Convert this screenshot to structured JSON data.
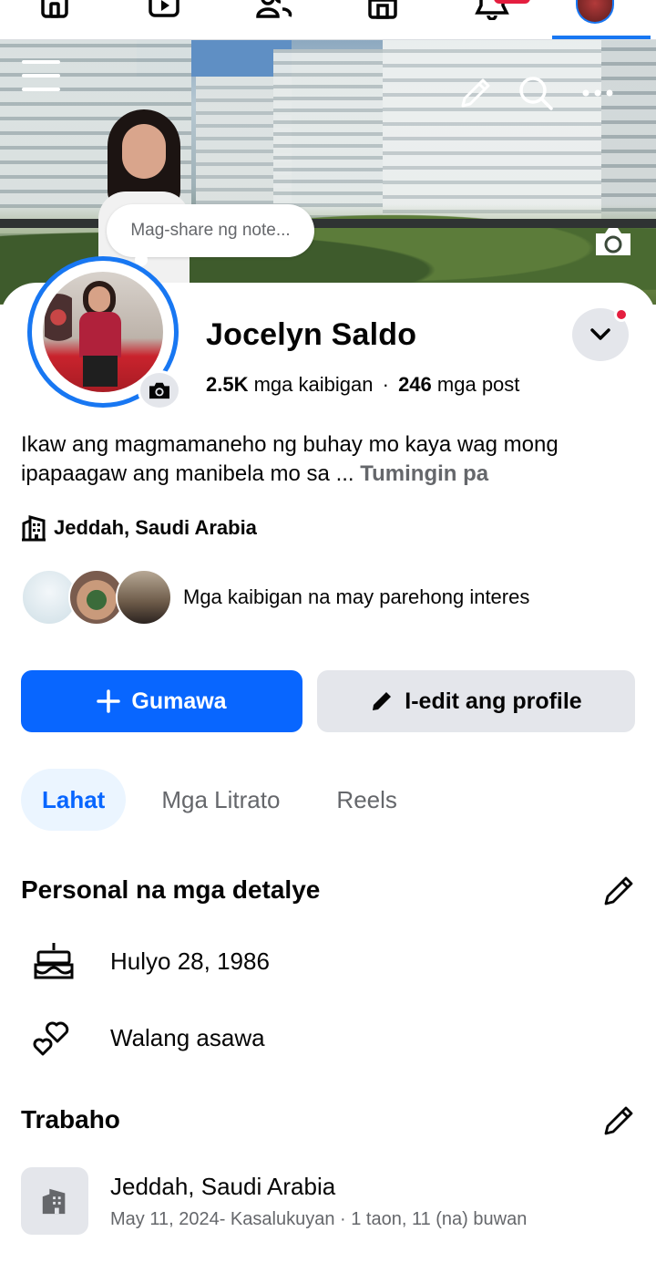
{
  "profile": {
    "name": "Jocelyn Saldo",
    "friends_count": "2.5K",
    "friends_label": "mga kaibigan",
    "separator": "·",
    "posts_count": "246",
    "posts_label": "mga post",
    "note_placeholder": "Mag-share ng note...",
    "bio": "Ikaw ang magmamaneho ng buhay mo kaya wag mong ipapaagaw ang manibela mo sa ...",
    "bio_more": "Tumingin pa",
    "location": "Jeddah, Saudi Arabia",
    "mutual_interest_text": "Mga kaibigan na may parehong interes"
  },
  "actions": {
    "create_label": "Gumawa",
    "edit_profile_label": "I-edit ang profile"
  },
  "tabs": [
    {
      "label": "Lahat",
      "active": true
    },
    {
      "label": "Mga Litrato",
      "active": false
    },
    {
      "label": "Reels",
      "active": false
    }
  ],
  "personal_details": {
    "title": "Personal na mga detalye",
    "birthday": "Hulyo 28, 1986",
    "relationship": "Walang asawa"
  },
  "work": {
    "title": "Trabaho",
    "place": "Jeddah, Saudi Arabia",
    "period": "May 11, 2024- Kasalukuyan · 1 taon, 11 (na) buwan"
  },
  "colors": {
    "accent": "#0866ff",
    "nav_active": "#1877f2",
    "secondary_button": "#e4e6eb",
    "muted_text": "#65676b",
    "notification_red": "#e41e3f"
  },
  "icons": {
    "nav": [
      "home-icon",
      "video-icon",
      "friends-icon",
      "marketplace-icon",
      "bell-icon",
      "profile-avatar"
    ],
    "cover": [
      "menu-icon",
      "pencil-icon",
      "search-icon",
      "more-icon",
      "camera-icon"
    ]
  }
}
